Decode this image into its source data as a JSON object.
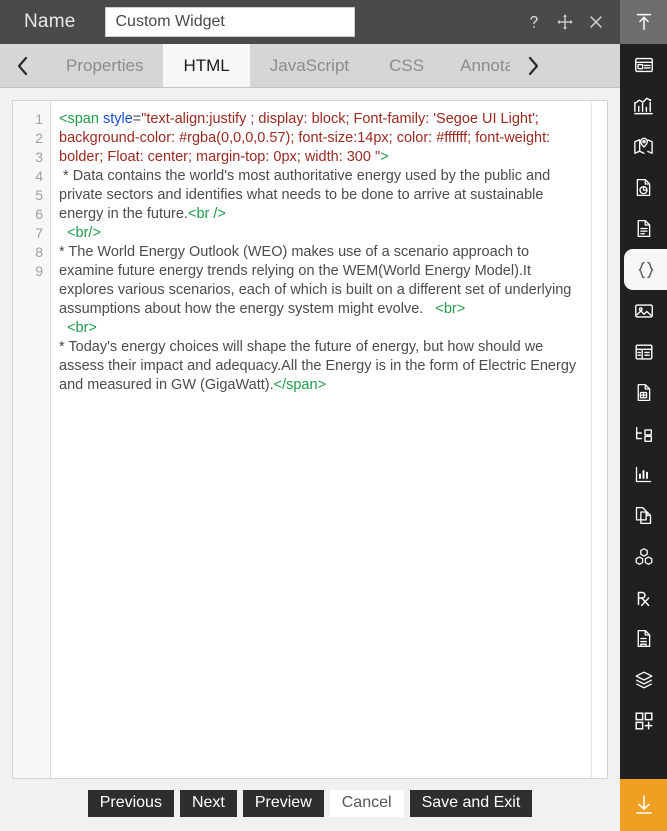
{
  "titlebar": {
    "label": "Name",
    "name_value": "Custom Widget",
    "name_placeholder": "Name",
    "controls": [
      {
        "name": "help-icon",
        "glyph": "?"
      },
      {
        "name": "move-icon",
        "glyph": "✥"
      },
      {
        "name": "close-icon",
        "glyph": "✕"
      }
    ]
  },
  "tabs": {
    "prev_arrow": "‹",
    "next_arrow": "›",
    "items": [
      {
        "label": "Properties",
        "active": false
      },
      {
        "label": "HTML",
        "active": true
      },
      {
        "label": "JavaScript",
        "active": false
      },
      {
        "label": "CSS",
        "active": false
      },
      {
        "label": "Annota",
        "active": false
      }
    ]
  },
  "editor": {
    "line_numbers": [
      "1",
      "2",
      "3",
      "4",
      "5",
      "6",
      "7",
      "8",
      "9"
    ],
    "lines": [
      {
        "n": "1",
        "parts": [
          {
            "t": "tag",
            "s": "<span "
          },
          {
            "t": "attr",
            "s": "style"
          },
          {
            "t": "plain",
            "s": "="
          },
          {
            "t": "str",
            "s": "\"text-align:justify ; display: block; Font-family: 'Segoe UI Light'; background-color: #rgba(0,0,0,0.57); font-size:14px; color: #ffffff; font-weight: bolder; Float: center; margin-top: 0px; width: 300 \""
          },
          {
            "t": "tag",
            "s": ">"
          }
        ]
      },
      {
        "n": "2",
        "parts": [
          {
            "t": "plain",
            "s": " * Data contains the world's most authoritative energy used by the public and private sectors and identifies what needs to be done to arrive at sustainable energy in the future."
          },
          {
            "t": "tag",
            "s": "<br />"
          }
        ]
      },
      {
        "n": "3",
        "parts": [
          {
            "t": "tag",
            "s": "  <br/>"
          }
        ]
      },
      {
        "n": "4",
        "parts": [
          {
            "t": "plain",
            "s": "* The World Energy Outlook (WEO) makes use of a scenario approach to examine future energy trends relying on the WEM(World Energy Model).It explores various scenarios, each of which is built on a different set of underlying assumptions about how the energy system might evolve.   "
          },
          {
            "t": "tag",
            "s": "<br>"
          }
        ]
      },
      {
        "n": "5",
        "parts": [
          {
            "t": "tag",
            "s": "  <br>"
          }
        ]
      },
      {
        "n": "6",
        "parts": [
          {
            "t": "plain",
            "s": "* Today's energy choices will shape the future of energy, but how should we assess their impact and adequacy.All the Energy is in the form of Electric Energy and measured in GW (GigaWatt)."
          },
          {
            "t": "tag",
            "s": "</span>"
          }
        ]
      },
      {
        "n": "7",
        "parts": []
      },
      {
        "n": "8",
        "parts": []
      },
      {
        "n": "9",
        "parts": []
      }
    ]
  },
  "footer": {
    "buttons": [
      {
        "label": "Previous",
        "style": "dark"
      },
      {
        "label": "Next",
        "style": "dark"
      },
      {
        "label": "Preview",
        "style": "dark"
      },
      {
        "label": "Cancel",
        "style": "light"
      },
      {
        "label": "Save and Exit",
        "style": "dark"
      }
    ]
  },
  "rail": {
    "items": [
      {
        "name": "export-upload-icon",
        "state": "top"
      },
      {
        "name": "dashboard-icon",
        "state": "normal"
      },
      {
        "name": "chart-analytics-icon",
        "state": "normal"
      },
      {
        "name": "map-pin-icon",
        "state": "normal"
      },
      {
        "name": "report-pie-icon",
        "state": "normal"
      },
      {
        "name": "document-icon",
        "state": "normal"
      },
      {
        "name": "code-braces-icon",
        "state": "active"
      },
      {
        "name": "image-icon",
        "state": "normal"
      },
      {
        "name": "table-widget-icon",
        "state": "normal"
      },
      {
        "name": "data-grid-file-icon",
        "state": "normal"
      },
      {
        "name": "hierarchy-tree-icon",
        "state": "normal"
      },
      {
        "name": "bar-chart-icon",
        "state": "normal"
      },
      {
        "name": "copy-page-icon",
        "state": "normal"
      },
      {
        "name": "cubes-icon",
        "state": "normal"
      },
      {
        "name": "prescription-rx-icon",
        "state": "normal"
      },
      {
        "name": "saved-document-icon",
        "state": "normal"
      },
      {
        "name": "layers-icon",
        "state": "normal"
      },
      {
        "name": "add-widget-icon",
        "state": "normal"
      },
      {
        "name": "download-icon",
        "state": "bottom"
      }
    ]
  },
  "colors": {
    "titlebar_bg": "#4a4a4a",
    "rail_bg": "#202020",
    "accent_orange": "#f0a020",
    "tab_active_bg": "#f7f7f7",
    "button_dark": "#2e2e2e",
    "syntax_tag": "#1f9b4a",
    "syntax_attr": "#1a4fd0",
    "syntax_string": "#9b2a20"
  }
}
